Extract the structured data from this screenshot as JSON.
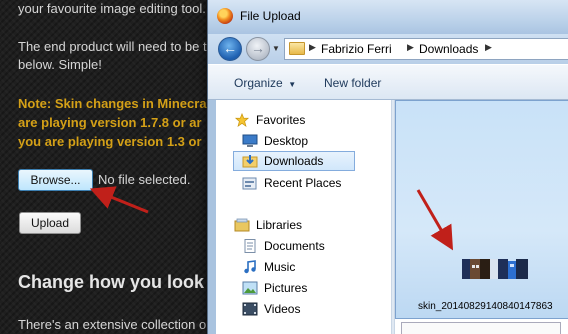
{
  "page": {
    "line1": "your favourite image editing tool.",
    "line2": "The end product will need to be t",
    "line3": "below. Simple!",
    "note_line1": "Note: Skin changes in Minecra",
    "note_line2": "are playing version 1.7.8 or ar",
    "note_line3": "you are playing version 1.3 or",
    "browse_label": "Browse...",
    "no_file_text": "No file selected.",
    "upload_label": "Upload",
    "section_heading": "Change how you look",
    "bottom_text": "There's an extensive collection o"
  },
  "dialog": {
    "title": "File Upload",
    "breadcrumb": [
      "Fabrizio Ferri",
      "Downloads"
    ],
    "toolbar": {
      "organize_label": "Organize",
      "new_folder_label": "New folder"
    },
    "favorites": {
      "label": "Favorites",
      "items": [
        "Desktop",
        "Downloads",
        "Recent Places"
      ],
      "selected": "Downloads"
    },
    "libraries": {
      "label": "Libraries",
      "items": [
        "Documents",
        "Music",
        "Pictures",
        "Videos"
      ]
    },
    "file": {
      "name": "skin_20140829140840147863"
    }
  },
  "colors": {
    "note_text": "#d4a017",
    "annotation_arrow": "#c0201a",
    "selection_border": "#84acdd"
  },
  "icons": [
    "firefox-icon",
    "back-arrow-icon",
    "forward-arrow-icon",
    "folder-icon",
    "star-icon",
    "desktop-icon",
    "recent-places-icon",
    "libraries-icon",
    "documents-icon",
    "music-icon",
    "pictures-icon",
    "videos-icon"
  ]
}
